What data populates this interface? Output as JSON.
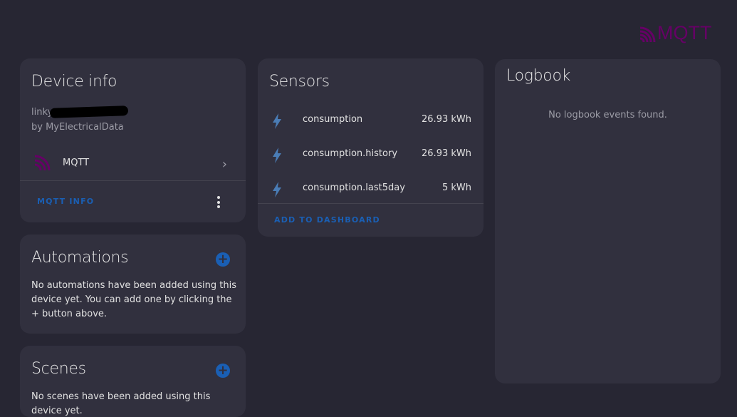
{
  "header": {
    "logo_text": "MQTT",
    "logo_color": "#660066"
  },
  "device_info": {
    "title": "Device info",
    "device_name": "linky",
    "manufacturer": "by MyElectricalData",
    "integration": {
      "icon": "mqtt-icon",
      "label": "MQTT"
    },
    "action_label": "MQTT INFO",
    "menu_icon": "more-vert-icon"
  },
  "automations": {
    "title": "Automations",
    "add_icon": "plus-circle-icon",
    "empty_text": "No automations have been added using this device yet. You can add one by clicking the + button above."
  },
  "scenes": {
    "title": "Scenes",
    "add_icon": "plus-circle-icon",
    "empty_text": "No scenes have been added using this device yet."
  },
  "sensors": {
    "title": "Sensors",
    "items": [
      {
        "icon": "flash-icon",
        "name": "consumption",
        "value": "26.93 kWh"
      },
      {
        "icon": "flash-icon",
        "name": "consumption.history",
        "value": "26.93 kWh"
      },
      {
        "icon": "flash-icon",
        "name": "consumption.last5day",
        "value": "5 kWh"
      }
    ],
    "action_label": "ADD TO DASHBOARD"
  },
  "logbook": {
    "title": "Logbook",
    "empty_text": "No logbook events found."
  },
  "colors": {
    "background": "#272633",
    "card": "#31303e",
    "accent": "#1a5fb4",
    "icon": "#4a7cb5",
    "brand": "#660066"
  }
}
